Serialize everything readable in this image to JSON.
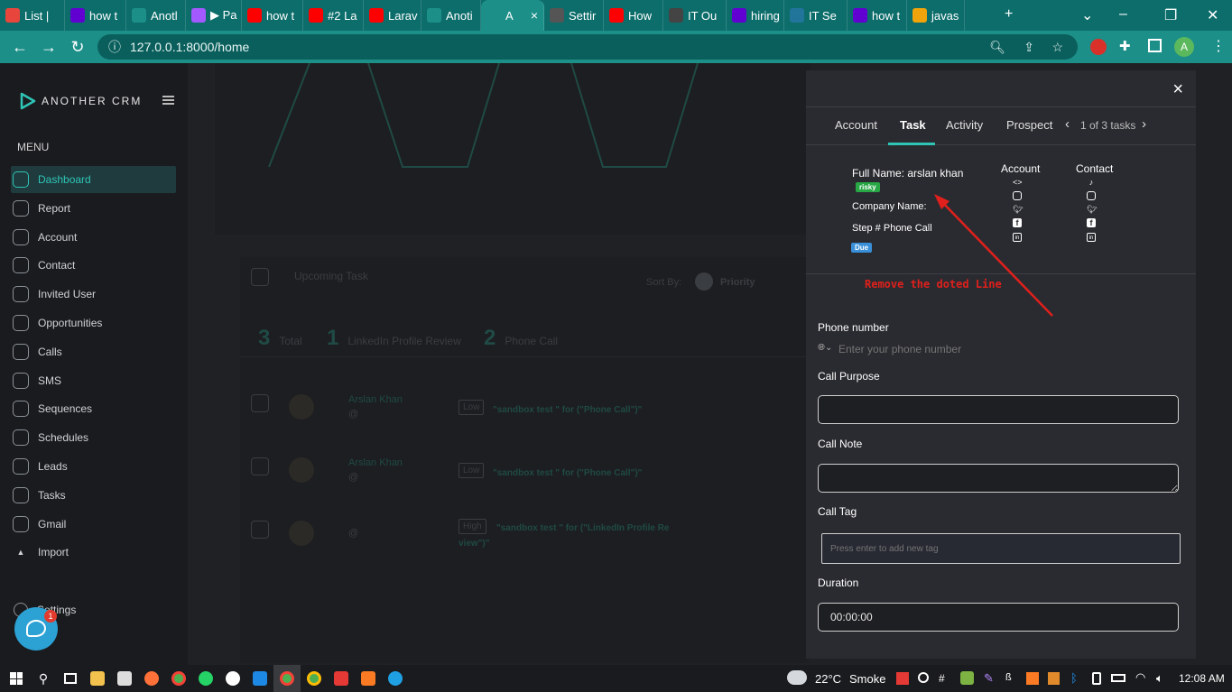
{
  "browser": {
    "tabs": [
      {
        "label": "List |",
        "color": "#e8453c"
      },
      {
        "label": "how t",
        "color": "#6001d2"
      },
      {
        "label": "Anotl",
        "color": "#1c8f89"
      },
      {
        "label": "▶ Pa",
        "color": "#a259ff"
      },
      {
        "label": "how t",
        "color": "#ff0000"
      },
      {
        "label": "#2 La",
        "color": "#ff0000"
      },
      {
        "label": "Larav",
        "color": "#ff0000"
      },
      {
        "label": "Anoti",
        "color": "#1c8f89"
      },
      {
        "label": "A",
        "color": "#1c8f89"
      },
      {
        "label": "Settir",
        "color": "#555555"
      },
      {
        "label": "How",
        "color": "#ff0000"
      },
      {
        "label": "IT Ou",
        "color": "#444444"
      },
      {
        "label": "hiring",
        "color": "#6001d2"
      },
      {
        "label": "IT Se",
        "color": "#21759b"
      },
      {
        "label": "how t",
        "color": "#6001d2"
      },
      {
        "label": "javas",
        "color": "#f0a30a"
      }
    ],
    "url": "127.0.0.1:8000/home",
    "profile_initial": "A"
  },
  "sidebar": {
    "brand": "ANOTHER CRM",
    "menu_label": "MENU",
    "items": [
      {
        "label": "Dashboard"
      },
      {
        "label": "Report"
      },
      {
        "label": "Account"
      },
      {
        "label": "Contact"
      },
      {
        "label": "Invited User"
      },
      {
        "label": "Opportunities"
      },
      {
        "label": "Calls"
      },
      {
        "label": "SMS"
      },
      {
        "label": "Sequences"
      },
      {
        "label": "Schedules"
      },
      {
        "label": "Leads"
      },
      {
        "label": "Tasks"
      },
      {
        "label": "Gmail"
      },
      {
        "label": "Import"
      }
    ],
    "settings_label": "Settings",
    "chat_badge": "1"
  },
  "background": {
    "upcoming_title": "Upcoming Task",
    "sort_by": "Sort By:",
    "priority": "Priority",
    "stats": [
      {
        "num": "3",
        "label": "Total"
      },
      {
        "num": "1",
        "label": "LinkedIn Profile Review"
      },
      {
        "num": "2",
        "label": "Phone Call"
      }
    ],
    "rows": [
      {
        "name": "Arslan Khan",
        "at": "@",
        "priority": "Low",
        "text": "\"sandbox test \" for (\"Phone Call\")\""
      },
      {
        "name": "Arslan Khan",
        "at": "@",
        "priority": "Low",
        "text": "\"sandbox test \" for (\"Phone Call\")\""
      },
      {
        "name": "",
        "at": "@",
        "priority": "High",
        "text": "\"sandbox test \" for (\"LinkedIn Profile Re view\")\""
      }
    ]
  },
  "drawer": {
    "tabs": [
      "Account",
      "Task",
      "Activity",
      "Prospect"
    ],
    "pager": "1 of 3 tasks",
    "full_name": "Full Name: arslan khan",
    "risk_badge": "risky",
    "company_name": "Company Name:",
    "step": "Step # Phone Call",
    "due_badge": "Due",
    "account_heading": "Account",
    "contact_heading": "Contact",
    "annotation": "Remove the doted Line",
    "annotation_color": "#e0201c",
    "phone_label": "Phone number",
    "phone_placeholder": "Enter your phone number",
    "call_purpose_label": "Call Purpose",
    "call_note_label": "Call Note",
    "call_tag_label": "Call Tag",
    "call_tag_placeholder": "Press enter to add new tag",
    "duration_label": "Duration",
    "duration_value": "00:00:00"
  },
  "taskbar": {
    "temperature": "22°C",
    "weather": "Smoke",
    "time": "12:08 AM"
  },
  "colors": {
    "accent": "#2ec4b6",
    "browser_chrome": "#1c8f89",
    "risky": "#28a745",
    "due": "#3a8fd9"
  }
}
